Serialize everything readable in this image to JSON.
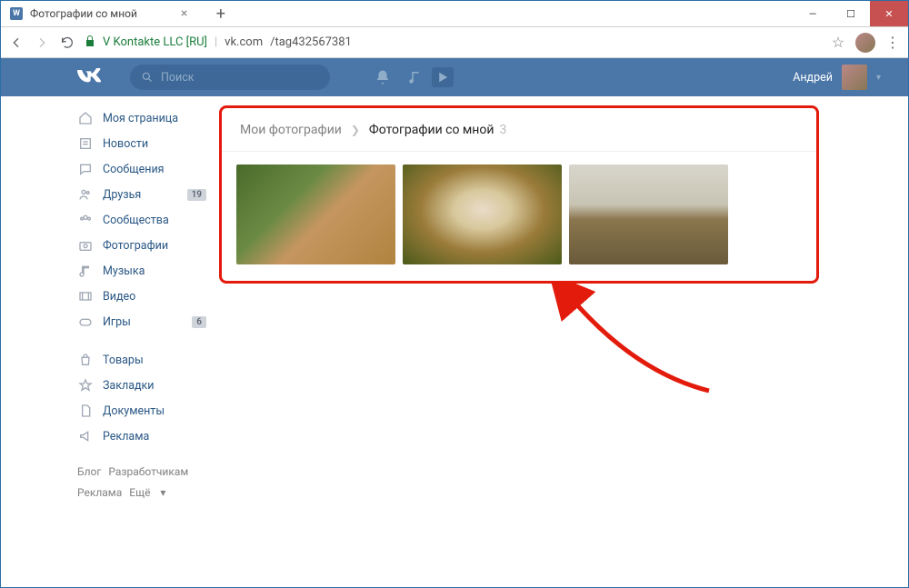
{
  "browser": {
    "tab_title": "Фотографии со мной",
    "url_org": "V Kontakte LLC [RU]",
    "url_host": "vk.com",
    "url_path": "/tag432567381"
  },
  "header": {
    "search_placeholder": "Поиск",
    "username": "Андрей"
  },
  "sidebar": {
    "items": [
      {
        "icon": "home",
        "label": "Моя страница"
      },
      {
        "icon": "news",
        "label": "Новости"
      },
      {
        "icon": "msg",
        "label": "Сообщения"
      },
      {
        "icon": "friends",
        "label": "Друзья",
        "badge": "19"
      },
      {
        "icon": "groups",
        "label": "Сообщества"
      },
      {
        "icon": "photos",
        "label": "Фотографии"
      },
      {
        "icon": "music",
        "label": "Музыка"
      },
      {
        "icon": "video",
        "label": "Видео"
      },
      {
        "icon": "games",
        "label": "Игры",
        "badge": "6"
      }
    ],
    "items2": [
      {
        "icon": "market",
        "label": "Товары"
      },
      {
        "icon": "fav",
        "label": "Закладки"
      },
      {
        "icon": "docs",
        "label": "Документы"
      },
      {
        "icon": "ads",
        "label": "Реклама"
      }
    ],
    "footer": {
      "blog": "Блог",
      "dev": "Разработчикам",
      "ads": "Реклама",
      "more": "Ещё"
    }
  },
  "breadcrumb": {
    "root": "Мои фотографии",
    "leaf": "Фотографии со мной",
    "count": "3"
  }
}
